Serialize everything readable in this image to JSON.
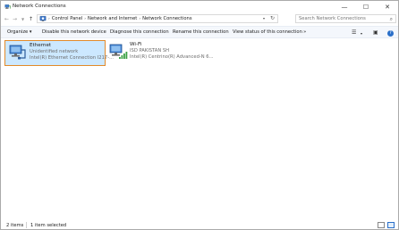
{
  "window": {
    "title": "Network Connections",
    "controls": {
      "minimize": "—",
      "maximize": "☐",
      "close": "✕"
    }
  },
  "navigation": {
    "back_icon": "arrow-left-icon",
    "forward_icon": "arrow-right-icon",
    "recent_icon": "chevron-down-icon",
    "up_icon": "arrow-up-icon",
    "breadcrumbs": [
      "Control Panel",
      "Network and Internet",
      "Network Connections"
    ],
    "search_placeholder": "Search Network Connections"
  },
  "commands": {
    "organize": "Organize ▾",
    "disable": "Disable this network device",
    "diagnose": "Diagnose this connection",
    "rename": "Rename this connection",
    "view_status": "View status of this connection",
    "more": "»"
  },
  "items": [
    {
      "name": "Ethernet",
      "status": "Unidentified network",
      "adapter": "Intel(R) Ethernet Connection I217-...",
      "selected": true,
      "icon": "ethernet-adapter-icon"
    },
    {
      "name": "Wi-Fi",
      "status": "ISD PAKISTAN SH",
      "adapter": "Intel(R) Centrino(R) Advanced-N 6...",
      "selected": false,
      "icon": "wifi-adapter-icon"
    }
  ],
  "statusbar": {
    "count": "2 items",
    "selected": "1 item selected"
  },
  "colors": {
    "selection_bg": "#cce8ff",
    "selection_border": "#e38a2a",
    "command_bar_bg": "#f4f7fc",
    "accent": "#2a6fc9"
  }
}
